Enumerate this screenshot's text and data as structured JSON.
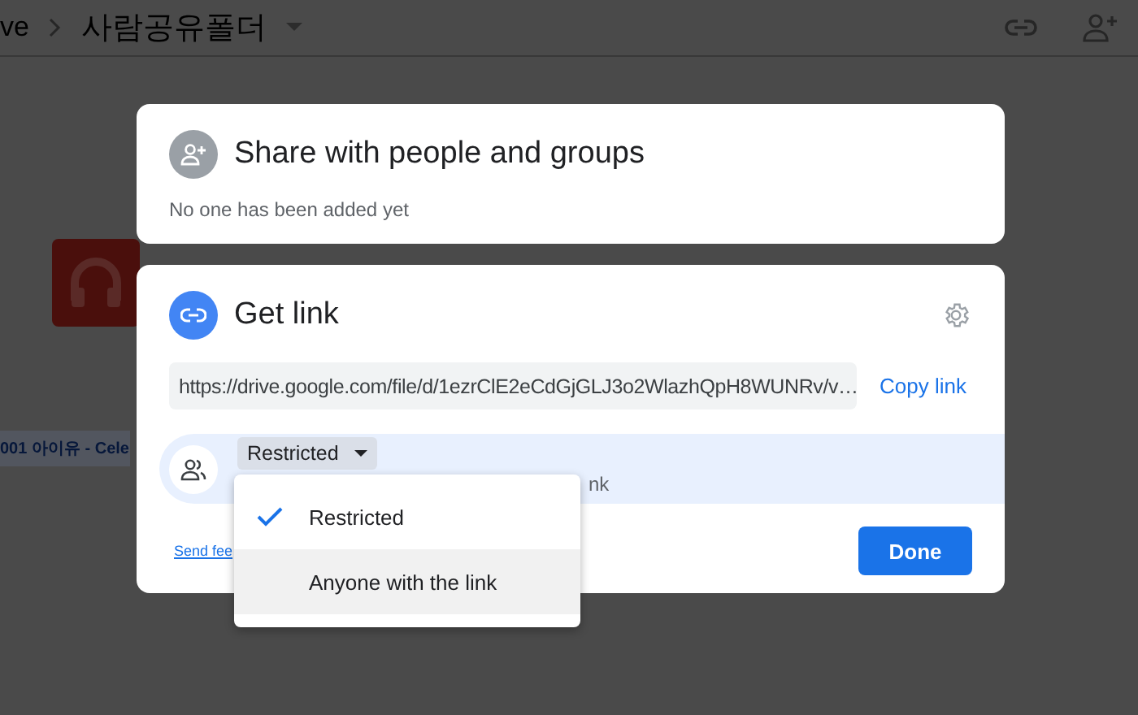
{
  "breadcrumb": {
    "parent": "ve",
    "folder": "사람공유폴더"
  },
  "background_file": {
    "name": "001 아이유 - Cele"
  },
  "share_card": {
    "title": "Share with people and groups",
    "subtitle": "No one has been added yet"
  },
  "link_card": {
    "title": "Get link",
    "url": "https://drive.google.com/file/d/1ezrClE2eCdGjGLJ3o2WlazhQpH8WUNRv/v…",
    "copy_label": "Copy link",
    "access": {
      "value": "Restricted",
      "description": "nk"
    },
    "feedback_link": "Send fee",
    "done_label": "Done"
  },
  "access_menu": {
    "items": [
      {
        "label": "Restricted",
        "selected": true,
        "hovered": false
      },
      {
        "label": "Anyone with the link",
        "selected": false,
        "hovered": true
      }
    ]
  }
}
